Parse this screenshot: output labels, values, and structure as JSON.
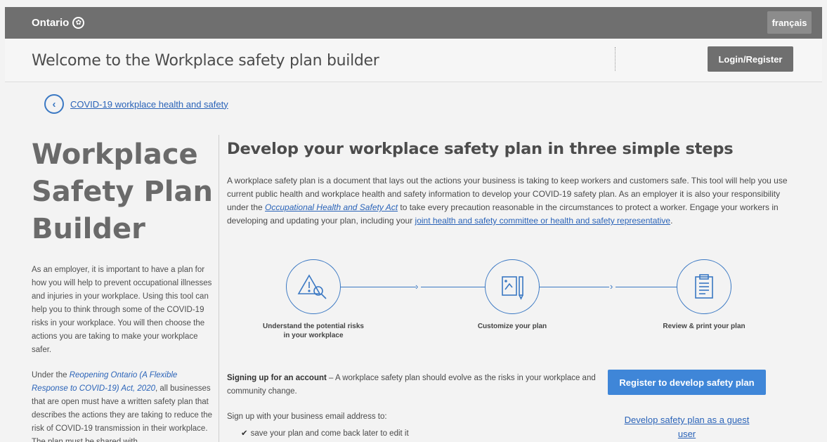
{
  "topbar": {
    "logo_text": "Ontario",
    "language_label": "français"
  },
  "header": {
    "title": "Welcome to the Workplace safety plan builder",
    "login_label": "Login/Register"
  },
  "breadcrumb": {
    "back_link": "COVID-19 workplace health and safety"
  },
  "sidebar": {
    "title_line1": "Workplace",
    "title_line2": "Safety Plan",
    "title_line3": "Builder",
    "para1": "As an employer, it is important to have a plan for how you will help to prevent occupational illnesses and injuries in your workplace. Using this tool can help you to think through some of the COVID-19 risks in your workplace. You will then choose the actions you are taking to make your workplace safer.",
    "para2_prefix": "Under the ",
    "para2_link": "Reopening Ontario (A Flexible Response to COVID-19) Act, 2020",
    "para2_suffix": ", all businesses that are open must have a written safety plan that describes the actions they are taking to reduce the risk of COVID-19 transmission in their workplace. The plan must be shared with"
  },
  "main": {
    "title": "Develop your workplace safety plan in three simple steps",
    "intro_part1": "A workplace safety plan is a document that lays out the actions your business is taking to keep workers and customers safe. This tool will help you use current public health and workplace health and safety information to develop your COVID-19 safety plan. As an employer it is also your responsibility under the ",
    "intro_link1": "Occupational Health and Safety Act",
    "intro_part2": " to take every precaution reasonable in the circumstances to protect a worker. Engage your workers in developing and updating your plan, including your ",
    "intro_link2": "joint health and safety committee or health and safety representative",
    "intro_part3": ".",
    "steps": [
      {
        "label": "Understand the potential risks in your workplace",
        "icon": "warning-magnifier-icon"
      },
      {
        "label": "Customize your plan",
        "icon": "edit-document-icon"
      },
      {
        "label": "Review & print your plan",
        "icon": "clipboard-checklist-icon"
      }
    ],
    "signup_bold": "Signing up for an account",
    "signup_rest": " – A workplace safety plan should evolve as the risks in your workplace and community change.",
    "signup_sub": "Sign up with your business email address to:",
    "check_item": "save your plan and come back later to edit it",
    "register_label": "Register to develop safety plan",
    "guest_label": "Develop safety plan as a guest user"
  },
  "colors": {
    "accent": "#3a78c3",
    "button_blue": "#3f86d8",
    "topbar": "#6f6f6f"
  }
}
